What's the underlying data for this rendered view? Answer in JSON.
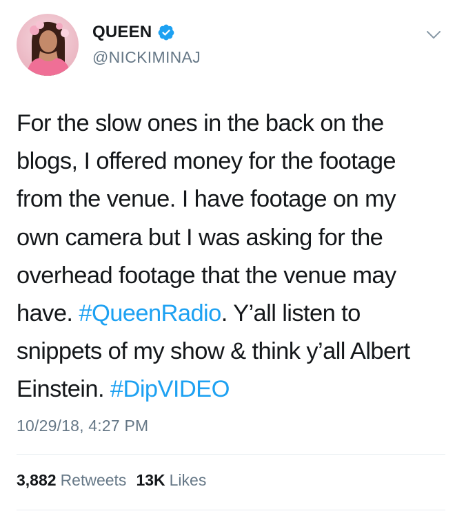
{
  "user": {
    "display_name": "QUEEN",
    "handle": "@NICKIMINAJ",
    "verified": true,
    "avatar_icon": "profile-photo"
  },
  "tweet": {
    "segments": [
      {
        "text": "For the slow ones in the back on the blogs, I offered money for the footage from the venue. I have footage on my own camera but I was asking for the overhead footage that the venue may have. ",
        "hashtag": false
      },
      {
        "text": "#QueenRadio",
        "hashtag": true
      },
      {
        "text": ". Y’all listen to snippets of my show & think y’all Albert Einstein. ",
        "hashtag": false
      },
      {
        "text": "#DipVIDEO",
        "hashtag": true
      }
    ],
    "timestamp": "10/29/18, 4:27 PM"
  },
  "stats": {
    "retweets_count": "3,882",
    "retweets_label": "Retweets",
    "likes_count": "13K",
    "likes_label": "Likes"
  },
  "colors": {
    "text": "#14171a",
    "secondary": "#657786",
    "link": "#1da1f2",
    "verified": "#1da1f2",
    "divider": "#e6ecf0"
  }
}
